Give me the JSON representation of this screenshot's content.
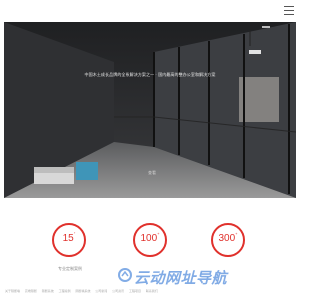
{
  "header": {
    "menu_icon": "hamburger-menu-icon"
  },
  "hero": {
    "tagline": "中国木土成长品牌的全系解决方案之一 · 国内最高的整办公室和解决方案",
    "button_label": "查看"
  },
  "stats": {
    "items": [
      {
        "value": "15",
        "suffix": "°"
      },
      {
        "value": "100",
        "suffix": "+"
      },
      {
        "value": "300",
        "suffix": "+"
      }
    ],
    "label": "专业定制案例"
  },
  "footer": {
    "links": [
      "关于隔断墙",
      "高端隔断",
      "隔断系统",
      "工程案例",
      "隔断墙系统",
      "公司新闻",
      "公司资讯",
      "工程项目",
      "联系我们"
    ]
  },
  "watermark": {
    "text": "云动网址导航"
  },
  "colors": {
    "accent": "#e0312c",
    "watermark": "#3f7fd8"
  }
}
